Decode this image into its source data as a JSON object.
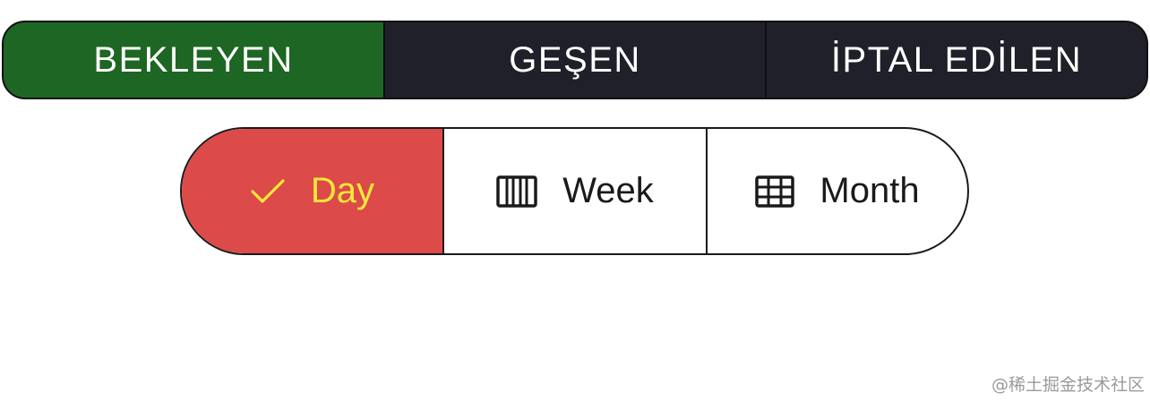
{
  "status_tabs": {
    "items": [
      {
        "label": "BEKLEYEN",
        "active": true
      },
      {
        "label": "GEŞEN",
        "active": false
      },
      {
        "label": "İPTAL EDİLEN",
        "active": false
      }
    ],
    "active_color": "#1e6623",
    "inactive_color": "#1f2029"
  },
  "range_selector": {
    "segments": [
      {
        "label": "Day",
        "icon": "check-icon",
        "selected": true
      },
      {
        "label": "Week",
        "icon": "week-columns-icon",
        "selected": false
      },
      {
        "label": "Month",
        "icon": "month-grid-icon",
        "selected": false
      }
    ],
    "selected_bg": "#dc4a4a",
    "selected_fg": "#f8e838"
  },
  "watermark": "@稀土掘金技术社区"
}
